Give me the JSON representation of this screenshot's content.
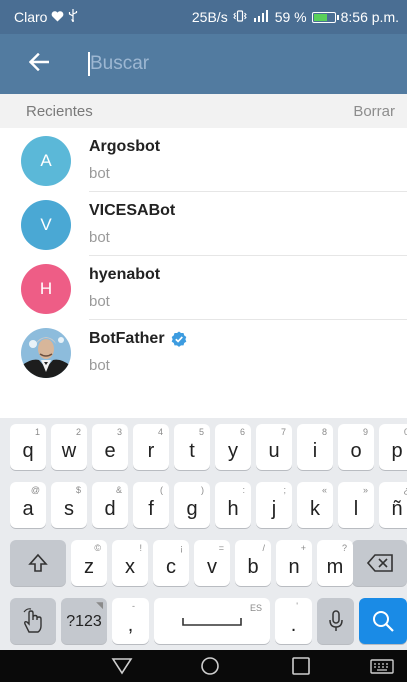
{
  "status_bar": {
    "carrier": "Claro",
    "network_speed": "25B/s",
    "battery_percent": "59 %",
    "battery_level": 0.59,
    "time": "8:56 p.m."
  },
  "search": {
    "placeholder": "Buscar",
    "value": ""
  },
  "recents": {
    "header": "Recientes",
    "clear_label": "Borrar",
    "items": [
      {
        "name": "Argosbot",
        "subtitle": "bot",
        "initial": "A",
        "color": "#5bb8d8",
        "verified": false
      },
      {
        "name": "VICESABot",
        "subtitle": "bot",
        "initial": "V",
        "color": "#4aa8d4",
        "verified": false
      },
      {
        "name": "hyenabot",
        "subtitle": "bot",
        "initial": "H",
        "color": "#ee5d86",
        "verified": false
      },
      {
        "name": "BotFather",
        "subtitle": "bot",
        "initial": "",
        "color": "#7fb2d5",
        "verified": true
      }
    ]
  },
  "keyboard": {
    "row1": [
      {
        "k": "q",
        "h": "1"
      },
      {
        "k": "w",
        "h": "2"
      },
      {
        "k": "e",
        "h": "3"
      },
      {
        "k": "r",
        "h": "4"
      },
      {
        "k": "t",
        "h": "5"
      },
      {
        "k": "y",
        "h": "6"
      },
      {
        "k": "u",
        "h": "7"
      },
      {
        "k": "i",
        "h": "8"
      },
      {
        "k": "o",
        "h": "9"
      },
      {
        "k": "p",
        "h": "0"
      }
    ],
    "row2": [
      {
        "k": "a",
        "h": "@"
      },
      {
        "k": "s",
        "h": "$"
      },
      {
        "k": "d",
        "h": "&"
      },
      {
        "k": "f",
        "h": "("
      },
      {
        "k": "g",
        "h": ")"
      },
      {
        "k": "h",
        "h": ":"
      },
      {
        "k": "j",
        "h": ";"
      },
      {
        "k": "k",
        "h": "«"
      },
      {
        "k": "l",
        "h": "»"
      },
      {
        "k": "ñ",
        "h": "¿"
      }
    ],
    "row3": [
      {
        "k": "z",
        "h": "©"
      },
      {
        "k": "x",
        "h": "!"
      },
      {
        "k": "c",
        "h": "¡"
      },
      {
        "k": "v",
        "h": "="
      },
      {
        "k": "b",
        "h": "/"
      },
      {
        "k": "n",
        "h": "+"
      },
      {
        "k": "m",
        "h": "?"
      }
    ],
    "symbols_label": "?123",
    "comma": ",",
    "comma_hint": "-",
    "space_label": "ES",
    "period": ".",
    "period_hint": "'"
  },
  "icons": {
    "back": "arrow-left-icon",
    "verified": "verified-check-icon",
    "shift": "shift-icon",
    "backspace": "backspace-icon",
    "gesture": "hand-gesture-icon",
    "mic": "microphone-icon",
    "search": "search-icon",
    "nav_back": "triangle-back-icon",
    "nav_home": "circle-home-icon",
    "nav_recents": "square-recents-icon",
    "nav_keyboard": "keyboard-icon"
  }
}
